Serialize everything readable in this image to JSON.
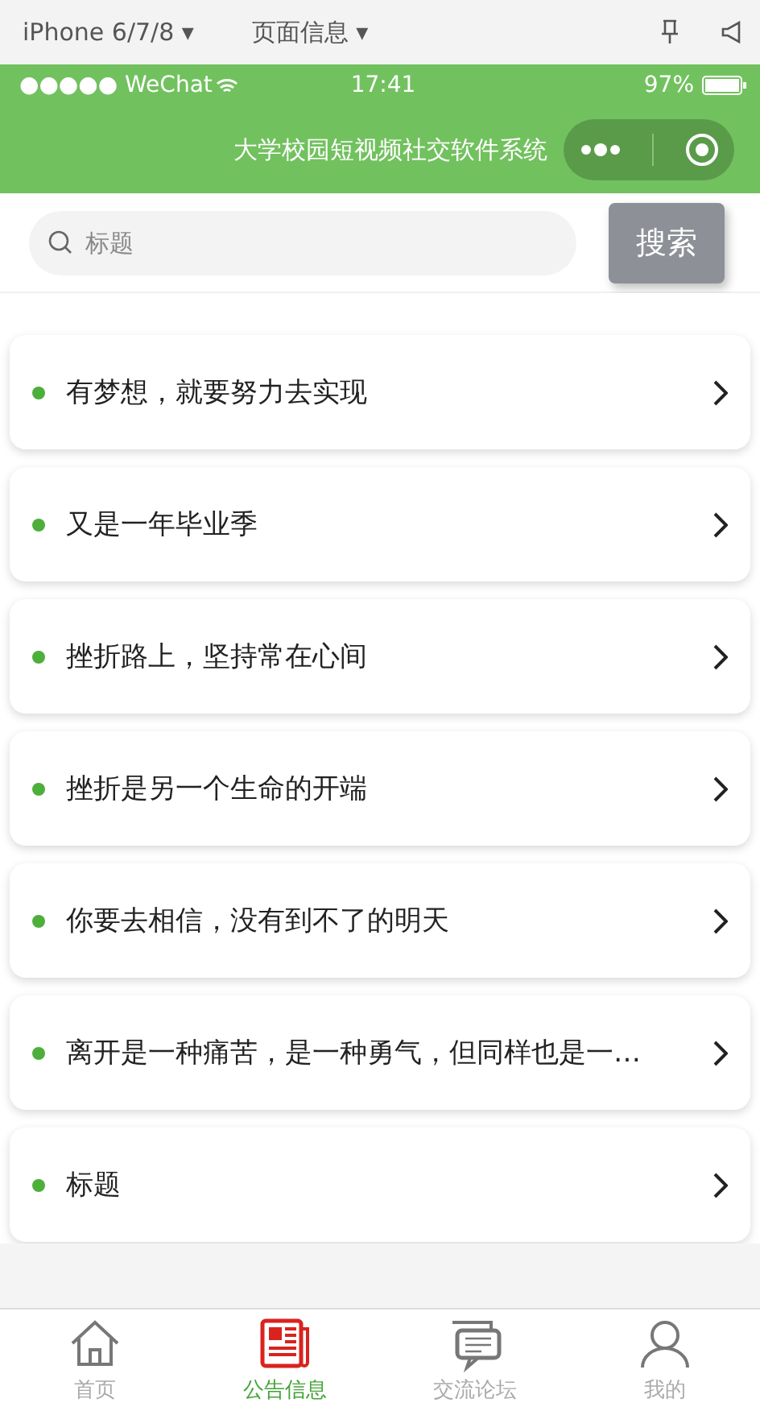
{
  "simulator": {
    "device": "iPhone 6/7/8 ▾",
    "page": "页面信息 ▾"
  },
  "status_bar": {
    "carrier": "●●●●● WeChat",
    "time": "17:41",
    "battery": "97%"
  },
  "nav": {
    "title": "大学校园短视频社交软件系统"
  },
  "search": {
    "placeholder": "标题",
    "button": "搜索"
  },
  "items": [
    {
      "title": "有梦想，就要努力去实现"
    },
    {
      "title": "又是一年毕业季"
    },
    {
      "title": "挫折路上，坚持常在心间"
    },
    {
      "title": "挫折是另一个生命的开端"
    },
    {
      "title": "你要去相信，没有到不了的明天"
    },
    {
      "title": "离开是一种痛苦，是一种勇气，但同样也是一…"
    },
    {
      "title": "标题"
    }
  ],
  "tabs": [
    {
      "label": "首页",
      "kind": "home",
      "selected": false
    },
    {
      "label": "公告信息",
      "kind": "news",
      "selected": true
    },
    {
      "label": "交流论坛",
      "kind": "forum",
      "selected": false
    },
    {
      "label": "我的",
      "kind": "user",
      "selected": false
    }
  ]
}
